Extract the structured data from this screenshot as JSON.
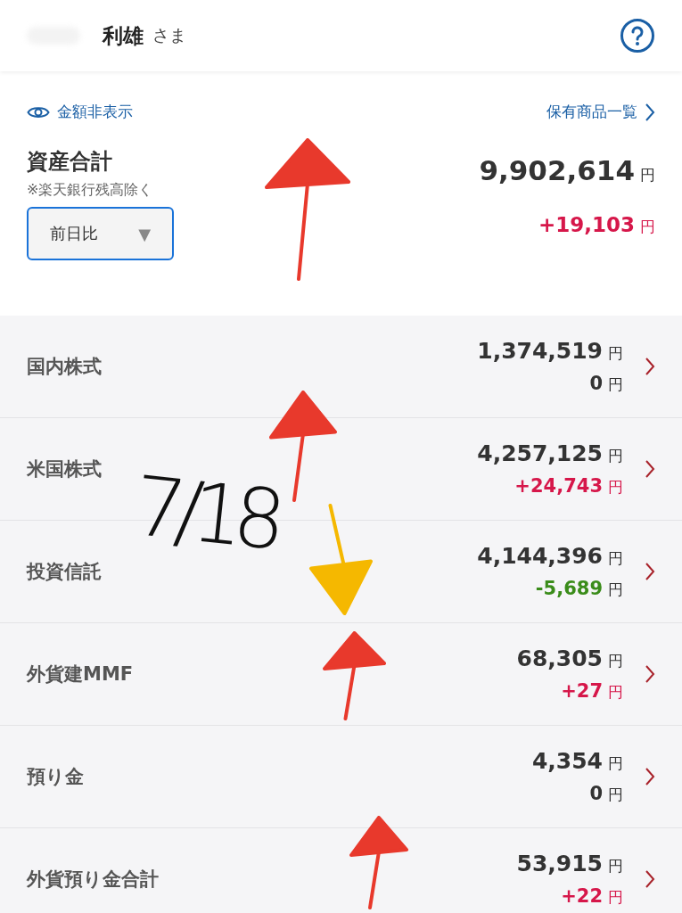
{
  "header": {
    "user_name": "利雄",
    "honorific": "さま"
  },
  "summary": {
    "hide_amounts": "金額非表示",
    "holdings_link": "保有商品一覧",
    "title": "資産合計",
    "note": "※楽天銀行残高除く",
    "period_select": "前日比",
    "dropdown_mark": "▼",
    "total": "9,902,614",
    "total_unit": "円",
    "change": "+19,103",
    "change_unit": "円",
    "color": "#d6174a"
  },
  "categories": [
    {
      "name": "国内株式",
      "amount": "1,374,519",
      "amount_unit": "円",
      "change": "0",
      "change_unit": "円",
      "color": "#333333"
    },
    {
      "name": "米国株式",
      "amount": "4,257,125",
      "amount_unit": "円",
      "change": "+24,743",
      "change_unit": "円",
      "color": "#d6174a"
    },
    {
      "name": "投資信託",
      "amount": "4,144,396",
      "amount_unit": "円",
      "change": "-5,689",
      "change_unit": "円",
      "color": "#3a8c1a"
    },
    {
      "name": "外貨建MMF",
      "amount": "68,305",
      "amount_unit": "円",
      "change": "+27",
      "change_unit": "円",
      "color": "#d6174a"
    },
    {
      "name": "預り金",
      "amount": "4,354",
      "amount_unit": "円",
      "change": "0",
      "change_unit": "円",
      "color": "#333333"
    },
    {
      "name": "外貨預り金合計",
      "amount": "53,915",
      "amount_unit": "円",
      "change": "+22",
      "change_unit": "円",
      "color": "#d6174a"
    }
  ],
  "annotations": {
    "date_note": "7/18",
    "arrows": [
      {
        "kind": "up",
        "color": "#e8392c"
      },
      {
        "kind": "up",
        "color": "#e8392c"
      },
      {
        "kind": "down",
        "color": "#f5b800"
      },
      {
        "kind": "up",
        "color": "#e8392c"
      },
      {
        "kind": "up",
        "color": "#e8392c"
      }
    ]
  }
}
